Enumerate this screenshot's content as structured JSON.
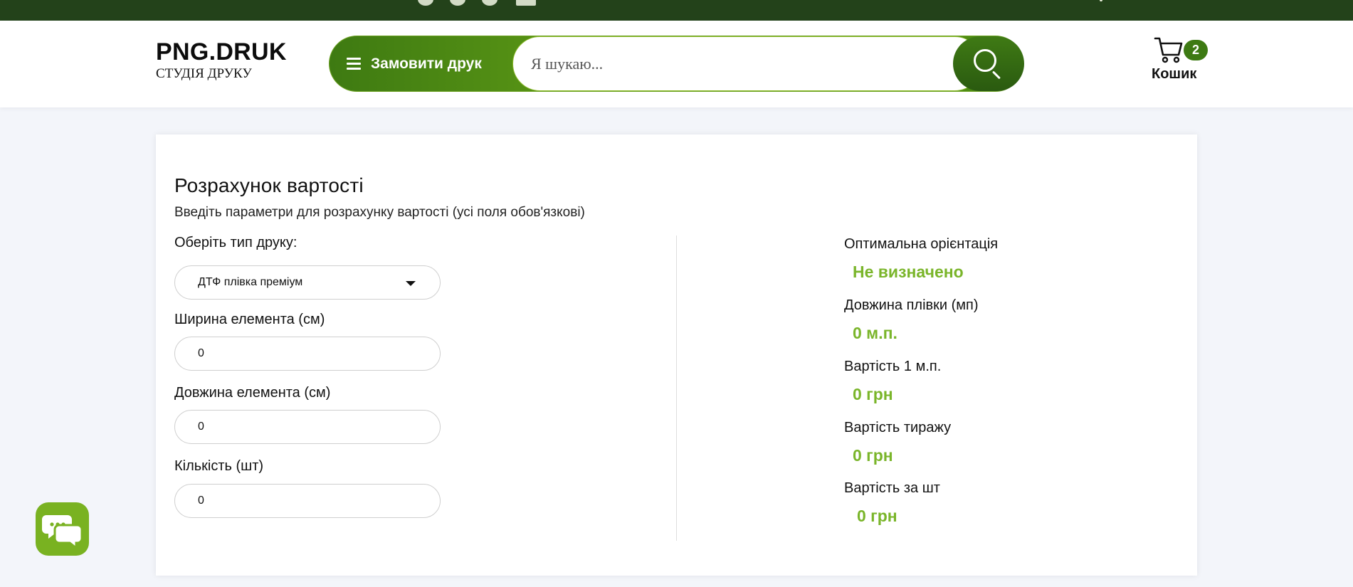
{
  "colors": {
    "topbar": "#23421a",
    "brand_green": "#4b8a13",
    "accent_green": "#7ab52a",
    "badge": "#3d7a13"
  },
  "header": {
    "logo_title": "PNG.DRUK",
    "logo_subtitle": "СТУДІЯ ДРУКУ",
    "order_button": "Замовити друк",
    "search_placeholder": "Я шукаю...",
    "cart_label": "Кошик",
    "cart_count": "2"
  },
  "calculator": {
    "title": "Розрахунок вартості",
    "subtitle": "Введіть параметри для розрахунку вартості (усі поля обов'язкові)",
    "print_type_label": "Оберіть тип друку:",
    "print_type_value": "ДТФ плівка преміум",
    "width_label": "Ширина елемента (см)",
    "width_value": "0",
    "length_label": "Довжина елемента (см)",
    "length_value": "0",
    "quantity_label": "Кількість (шт)",
    "quantity_value": "0"
  },
  "results": {
    "orientation_label": "Оптимальна орієнтація",
    "orientation_value": "Не визначено",
    "film_length_label": "Довжина плівки (мп)",
    "film_length_value": "0 м.п.",
    "price_per_meter_label": "Вартість 1 м.п.",
    "price_per_meter_value": "0 грн",
    "run_cost_label": "Вартість тиражу",
    "run_cost_value": "0 грн",
    "unit_cost_label": "Вартість за шт",
    "unit_cost_value": "0 грн"
  },
  "icons": {
    "menu": "hamburger-icon",
    "search": "search-icon",
    "cart": "cart-icon",
    "chat": "chat-bubbles-icon",
    "dropdown": "caret-down-icon"
  }
}
